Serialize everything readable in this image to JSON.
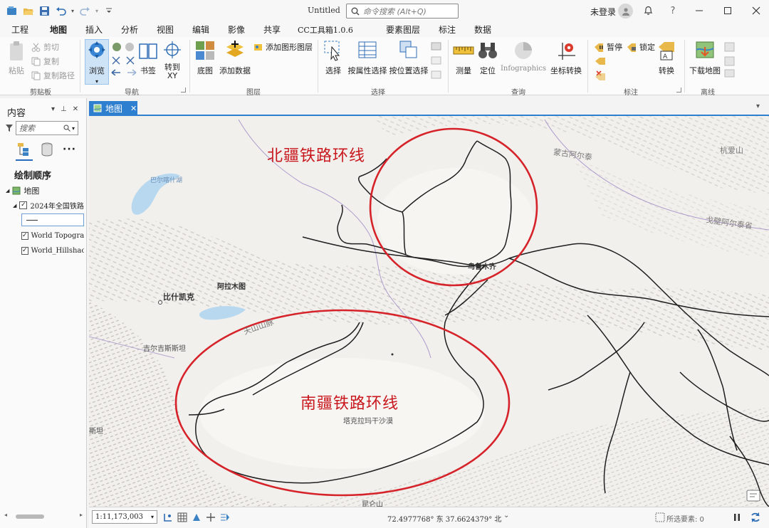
{
  "title_bar": {
    "document_title": "Untitled",
    "search_placeholder": "命令搜索 (Alt+Q)",
    "user_label": "未登录",
    "help_label": "?",
    "quick_access_icons": [
      "project-icon",
      "open-icon",
      "save-icon",
      "undo-icon",
      "redo-icon",
      "customize-icon"
    ]
  },
  "ribbon_tabs": [
    {
      "label": "工程"
    },
    {
      "label": "地图",
      "active": true
    },
    {
      "label": "插入"
    },
    {
      "label": "分析"
    },
    {
      "label": "视图"
    },
    {
      "label": "编辑"
    },
    {
      "label": "影像"
    },
    {
      "label": "共享"
    },
    {
      "label": "CC工具箱1.0.6"
    },
    {
      "label": "要素图层"
    },
    {
      "label": "标注"
    },
    {
      "label": "数据"
    }
  ],
  "ribbon": {
    "clipboard": {
      "paste": "粘贴",
      "cut": "剪切",
      "copy": "复制",
      "copy_path": "复制路径",
      "group": "剪贴板"
    },
    "navigate": {
      "explore": "浏览",
      "bookmarks": "书签",
      "goto_xy": "转到\nXY",
      "group": "导航"
    },
    "layer": {
      "basemap": "底图",
      "add_data": "添加数据",
      "add_graphics": "添加图形图层",
      "group": "图层"
    },
    "selection": {
      "select": "选择",
      "by_attribute": "按属性选择",
      "by_location": "按位置选择",
      "group": "选择"
    },
    "inquiry": {
      "measure": "测量",
      "locate": "定位",
      "infographics": "Infographics",
      "convert_coords": "坐标转换",
      "group": "查询"
    },
    "labeling": {
      "pause": "暂停",
      "lock": "锁定",
      "convert": "转换",
      "group": "标注"
    },
    "offline": {
      "download_map": "下载地图",
      "group": "离线"
    }
  },
  "contents_pane": {
    "title": "内容",
    "search_placeholder": "搜索",
    "drawing_order": "绘制顺序",
    "layers": [
      {
        "name": "地图",
        "checked": null
      },
      {
        "name": "2024年全国铁路",
        "checked": true
      },
      {
        "name": "World Topograp",
        "checked": true
      },
      {
        "name": "World_Hillshac",
        "checked": true
      }
    ]
  },
  "map_view": {
    "tab_label": "地图",
    "annotations": {
      "north_loop": "北疆铁路环线",
      "south_loop": "南疆铁路环线"
    },
    "places": {
      "balkhash": "巴尔喀什湖",
      "mongolian_altai": "蒙古阿尔泰",
      "hangai": "杭爱山",
      "gobi_altai": "戈壁阿尔泰省",
      "urumqi": "乌鲁木齐",
      "almaty": "阿拉木图",
      "bishkek": "比什凯克",
      "tianshan": "天山山脉",
      "kyrgyzstan": "吉尔吉斯斯坦",
      "taklamakan": "塔克拉玛干沙漠",
      "kunlun": "昆仑山",
      "xinjiang_edge": "斯坦"
    },
    "colors": {
      "annotation": "#c8171d",
      "railway": "#1e1e1e",
      "water": "#b8d8ef",
      "border": "#a592c8"
    }
  },
  "status_bar": {
    "scale": "1:11,173,003",
    "coordinates": "72.4977768° 东 37.6624379° 北",
    "selected_features": "所选要素: 0"
  }
}
